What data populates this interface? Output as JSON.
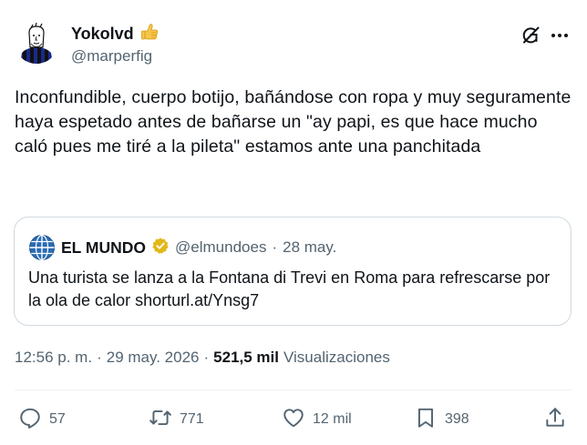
{
  "author": {
    "display_name": "Yokolvd",
    "handle": "@marperfig",
    "name_emoji": "thumbs-up"
  },
  "tweet": {
    "text": "Inconfundible, cuerpo botijo, bañándose con ropa y muy seguramente haya espetado antes de bañarse un \"ay papi, es que hace mucho caló pues me tiré a la pileta\" estamos ante una panchitada"
  },
  "quote": {
    "name": "EL MUNDO",
    "handle": "@elmundoes",
    "separator": "·",
    "date": "28 may.",
    "text": "Una turista se lanza a la Fontana di Trevi en Roma para refrescarse por la ola de calor shorturl.at/Ynsg7",
    "verified": "gold-check"
  },
  "meta": {
    "time": "12:56 p. m.",
    "sep1": "·",
    "date": "29 may. 2026",
    "sep2": "·",
    "views_count": "521,5 mil",
    "views_label": "Visualizaciones"
  },
  "actions": {
    "replies": "57",
    "reposts": "771",
    "likes": "12 mil",
    "bookmarks": "398"
  },
  "icons": {
    "grok": "grok-icon",
    "more": "more-icon",
    "reply": "reply-icon",
    "repost": "repost-icon",
    "like": "heart-icon",
    "bookmark": "bookmark-icon",
    "share": "share-icon"
  },
  "colors": {
    "text": "#0f1419",
    "secondary": "#536471",
    "border": "#cfd9de",
    "verified_gold": "#e2b719"
  }
}
